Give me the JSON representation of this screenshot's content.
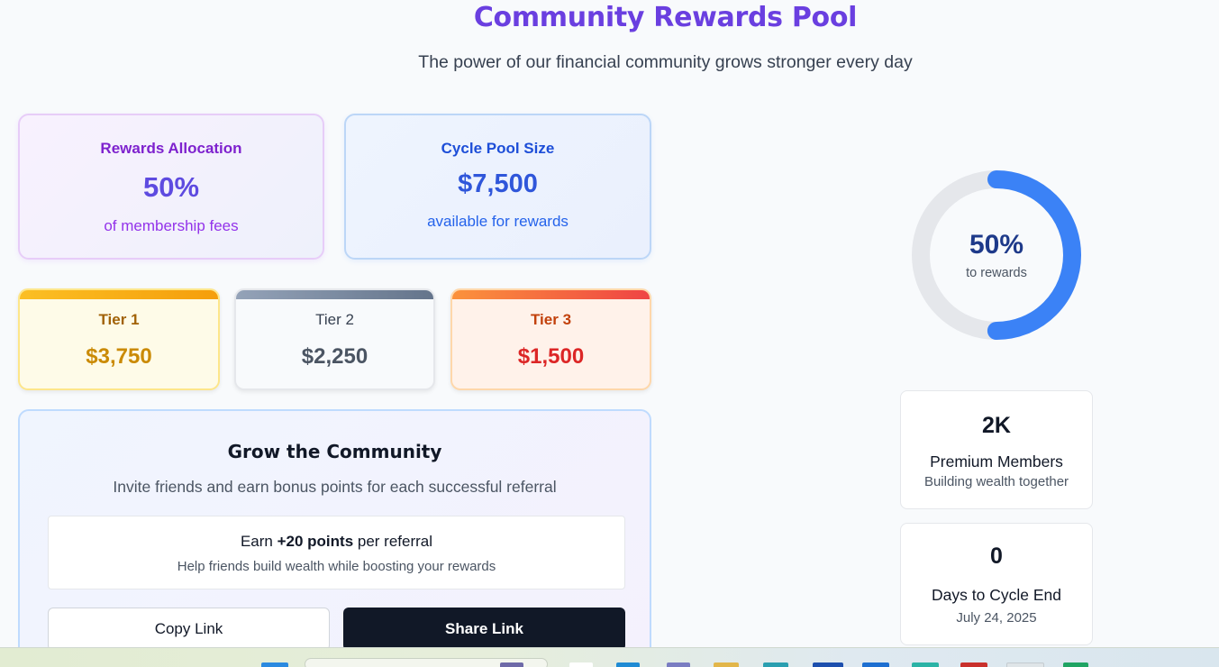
{
  "header": {
    "title": "Community Rewards Pool",
    "subtitle": "The power of our financial community grows stronger every day"
  },
  "allocation": {
    "label": "Rewards Allocation",
    "value": "50%",
    "sub": "of membership fees"
  },
  "pool": {
    "label": "Cycle Pool Size",
    "value": "$7,500",
    "sub": "available for rewards"
  },
  "tiers": [
    {
      "label": "Tier 1",
      "value": "$3,750"
    },
    {
      "label": "Tier 2",
      "value": "$2,250"
    },
    {
      "label": "Tier 3",
      "value": "$1,500"
    }
  ],
  "grow": {
    "title": "Grow the Community",
    "description": "Invite friends and earn bonus points for each successful referral",
    "earn_prefix": "Earn ",
    "earn_points": "+20 points",
    "earn_suffix": " per referral",
    "earn_sub": "Help friends build wealth while boosting your rewards",
    "copy_label": "Copy Link",
    "share_label": "Share Link"
  },
  "donut": {
    "percent_text": "50%",
    "label": "to rewards",
    "fraction": 0.5,
    "fill_color": "#3b82f6",
    "track_color": "#e5e7eb"
  },
  "stats": {
    "members": {
      "value": "2K",
      "label": "Premium Members",
      "sub": "Building wealth together"
    },
    "days": {
      "value": "0",
      "label": "Days to Cycle End",
      "sub": "July 24, 2025"
    }
  },
  "taskbar": {
    "icons": [
      "windows-start-icon",
      "search-icon",
      "file-explorer-icon",
      "edge-icon",
      "teams-icon",
      "folder-icon",
      "store-icon",
      "mail-icon",
      "outlook-icon",
      "copilot-icon",
      "gmail-icon",
      "chrome-icon",
      "sheets-icon"
    ]
  }
}
